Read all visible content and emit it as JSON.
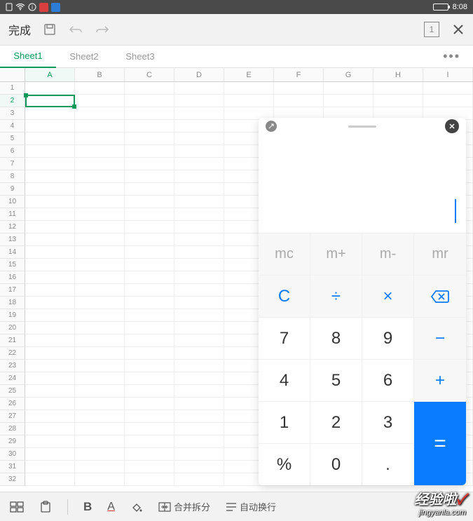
{
  "status": {
    "time": "8:08"
  },
  "toolbar": {
    "done": "完成",
    "page": "1"
  },
  "sheets": {
    "tabs": [
      "Sheet1",
      "Sheet2",
      "Sheet3"
    ],
    "active": 0,
    "more": "•••"
  },
  "grid": {
    "columns": [
      "A",
      "B",
      "C",
      "D",
      "E",
      "F",
      "G",
      "H",
      "I"
    ],
    "rowCount": 32,
    "selectedCol": "A",
    "selectedRow": 2
  },
  "calculator": {
    "display": "",
    "mem": {
      "mc": "mc",
      "mplus": "m+",
      "mminus": "m-",
      "mr": "mr"
    },
    "ops": {
      "clear": "C",
      "divide": "÷",
      "multiply": "×",
      "minus": "−",
      "plus": "+",
      "equals": "="
    },
    "nums": {
      "n7": "7",
      "n8": "8",
      "n9": "9",
      "n4": "4",
      "n5": "5",
      "n6": "6",
      "n1": "1",
      "n2": "2",
      "n3": "3",
      "n0": "0"
    },
    "percent": "%",
    "dot": "."
  },
  "bottom": {
    "merge": "合并拆分",
    "wrap": "自动换行"
  },
  "watermark": {
    "main": "经验啦",
    "check": "✓",
    "sub": "jingyanla.com"
  }
}
